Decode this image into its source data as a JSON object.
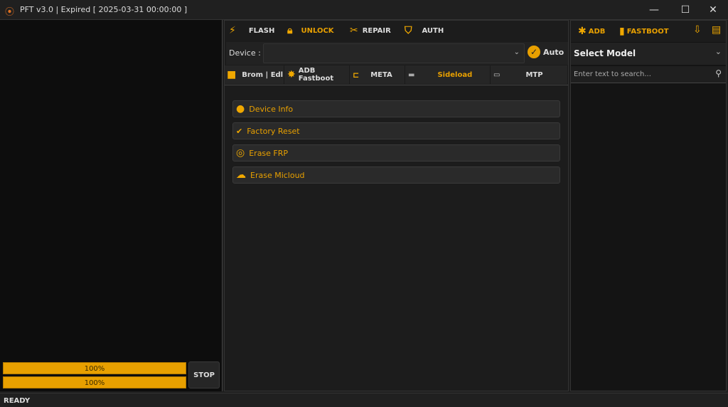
{
  "window": {
    "title": "PFT v3.0  | Expired [ 2025-03-31 00:00:00 ]",
    "minimize": "—",
    "maximize": "☐",
    "close": "✕"
  },
  "toolbar": {
    "items": [
      {
        "label": "FLASH",
        "icon": "lightning-icon"
      },
      {
        "label": "UNLOCK",
        "icon": "lock-icon"
      },
      {
        "label": "REPAIR",
        "icon": "tools-icon"
      },
      {
        "label": "AUTH",
        "icon": "shield-icon"
      }
    ]
  },
  "device": {
    "label": "Device :",
    "value": "",
    "auto_label": "Auto"
  },
  "tabs": [
    {
      "label": "Brom | Edl"
    },
    {
      "label": "ADB Fastboot"
    },
    {
      "label": "META"
    },
    {
      "label": "Sideload",
      "active": true
    },
    {
      "label": "MTP"
    }
  ],
  "actions": [
    {
      "label": "Device Info",
      "icon": "info-icon"
    },
    {
      "label": "Factory Reset",
      "icon": "broom-icon"
    },
    {
      "label": "Erase FRP",
      "icon": "refresh-icon"
    },
    {
      "label": "Erase Micloud",
      "icon": "cloud-icon"
    }
  ],
  "right": {
    "adb": "ADB",
    "fastboot": "FASTBOOT",
    "select_model": "Select Model",
    "search_placeholder": "Enter text to search..."
  },
  "progress": [
    {
      "value": 100,
      "label": "100%"
    },
    {
      "value": 100,
      "label": "100%"
    }
  ],
  "stop_label": "STOP",
  "status": "READY",
  "colors": {
    "accent": "#e8a000",
    "background": "#1e1e1e"
  }
}
